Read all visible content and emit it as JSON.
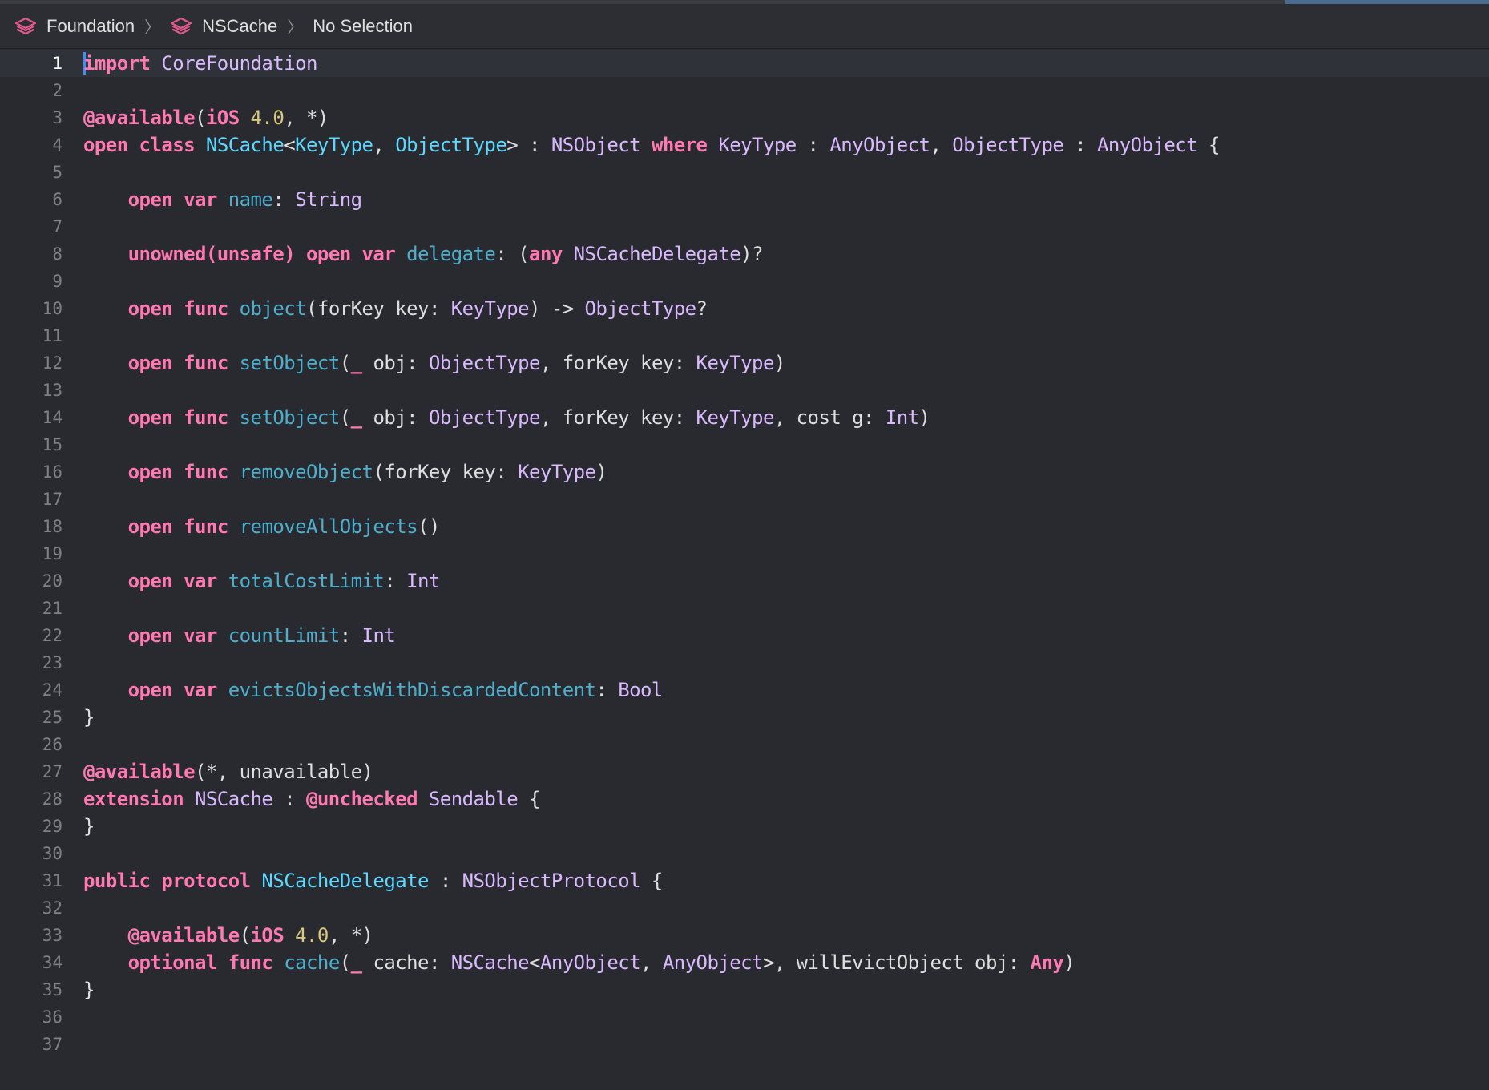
{
  "breadcrumb": {
    "items": [
      "Foundation",
      "NSCache",
      "No Selection"
    ]
  },
  "editor": {
    "current_line": 1,
    "lines": [
      {
        "n": "1",
        "tokens": [
          [
            "kw",
            "import"
          ],
          [
            "plain",
            " "
          ],
          [
            "ty",
            "CoreFoundation"
          ]
        ]
      },
      {
        "n": "2",
        "tokens": []
      },
      {
        "n": "3",
        "tokens": [
          [
            "attr",
            "@available"
          ],
          [
            "plain",
            "("
          ],
          [
            "kw",
            "iOS"
          ],
          [
            "plain",
            " "
          ],
          [
            "num",
            "4.0"
          ],
          [
            "plain",
            ", *)"
          ]
        ]
      },
      {
        "n": "4",
        "tokens": [
          [
            "kw",
            "open"
          ],
          [
            "plain",
            " "
          ],
          [
            "kw",
            "class"
          ],
          [
            "plain",
            " "
          ],
          [
            "decl",
            "NSCache"
          ],
          [
            "plain",
            "<"
          ],
          [
            "decl",
            "KeyType"
          ],
          [
            "plain",
            ", "
          ],
          [
            "decl",
            "ObjectType"
          ],
          [
            "plain",
            "> : "
          ],
          [
            "ty",
            "NSObject"
          ],
          [
            "plain",
            " "
          ],
          [
            "kw",
            "where"
          ],
          [
            "plain",
            " "
          ],
          [
            "ty",
            "KeyType"
          ],
          [
            "plain",
            " : "
          ],
          [
            "ty",
            "AnyObject"
          ],
          [
            "plain",
            ", "
          ],
          [
            "ty",
            "ObjectType"
          ],
          [
            "plain",
            " : "
          ],
          [
            "ty",
            "AnyObject"
          ],
          [
            "plain",
            " {"
          ]
        ]
      },
      {
        "n": "5",
        "tokens": []
      },
      {
        "n": "6",
        "tokens": [
          [
            "plain",
            "    "
          ],
          [
            "kw",
            "open"
          ],
          [
            "plain",
            " "
          ],
          [
            "kw",
            "var"
          ],
          [
            "plain",
            " "
          ],
          [
            "mem",
            "name"
          ],
          [
            "plain",
            ": "
          ],
          [
            "ty",
            "String"
          ]
        ]
      },
      {
        "n": "7",
        "tokens": []
      },
      {
        "n": "8",
        "tokens": [
          [
            "plain",
            "    "
          ],
          [
            "kw",
            "unowned(unsafe)"
          ],
          [
            "plain",
            " "
          ],
          [
            "kw",
            "open"
          ],
          [
            "plain",
            " "
          ],
          [
            "kw",
            "var"
          ],
          [
            "plain",
            " "
          ],
          [
            "mem",
            "delegate"
          ],
          [
            "plain",
            ": ("
          ],
          [
            "kw",
            "any"
          ],
          [
            "plain",
            " "
          ],
          [
            "ty",
            "NSCacheDelegate"
          ],
          [
            "plain",
            ")?"
          ]
        ]
      },
      {
        "n": "9",
        "tokens": []
      },
      {
        "n": "10",
        "tokens": [
          [
            "plain",
            "    "
          ],
          [
            "kw",
            "open"
          ],
          [
            "plain",
            " "
          ],
          [
            "kw",
            "func"
          ],
          [
            "plain",
            " "
          ],
          [
            "mem",
            "object"
          ],
          [
            "plain",
            "(forKey key: "
          ],
          [
            "ty",
            "KeyType"
          ],
          [
            "plain",
            ") -> "
          ],
          [
            "ty",
            "ObjectType"
          ],
          [
            "plain",
            "?"
          ]
        ]
      },
      {
        "n": "11",
        "tokens": []
      },
      {
        "n": "12",
        "tokens": [
          [
            "plain",
            "    "
          ],
          [
            "kw",
            "open"
          ],
          [
            "plain",
            " "
          ],
          [
            "kw",
            "func"
          ],
          [
            "plain",
            " "
          ],
          [
            "mem",
            "setObject"
          ],
          [
            "plain",
            "("
          ],
          [
            "kw",
            "_"
          ],
          [
            "plain",
            " obj: "
          ],
          [
            "ty",
            "ObjectType"
          ],
          [
            "plain",
            ", forKey key: "
          ],
          [
            "ty",
            "KeyType"
          ],
          [
            "plain",
            ")"
          ]
        ]
      },
      {
        "n": "13",
        "tokens": []
      },
      {
        "n": "14",
        "tokens": [
          [
            "plain",
            "    "
          ],
          [
            "kw",
            "open"
          ],
          [
            "plain",
            " "
          ],
          [
            "kw",
            "func"
          ],
          [
            "plain",
            " "
          ],
          [
            "mem",
            "setObject"
          ],
          [
            "plain",
            "("
          ],
          [
            "kw",
            "_"
          ],
          [
            "plain",
            " obj: "
          ],
          [
            "ty",
            "ObjectType"
          ],
          [
            "plain",
            ", forKey key: "
          ],
          [
            "ty",
            "KeyType"
          ],
          [
            "plain",
            ", cost g: "
          ],
          [
            "ty",
            "Int"
          ],
          [
            "plain",
            ")"
          ]
        ]
      },
      {
        "n": "15",
        "tokens": []
      },
      {
        "n": "16",
        "tokens": [
          [
            "plain",
            "    "
          ],
          [
            "kw",
            "open"
          ],
          [
            "plain",
            " "
          ],
          [
            "kw",
            "func"
          ],
          [
            "plain",
            " "
          ],
          [
            "mem",
            "removeObject"
          ],
          [
            "plain",
            "(forKey key: "
          ],
          [
            "ty",
            "KeyType"
          ],
          [
            "plain",
            ")"
          ]
        ]
      },
      {
        "n": "17",
        "tokens": []
      },
      {
        "n": "18",
        "tokens": [
          [
            "plain",
            "    "
          ],
          [
            "kw",
            "open"
          ],
          [
            "plain",
            " "
          ],
          [
            "kw",
            "func"
          ],
          [
            "plain",
            " "
          ],
          [
            "mem",
            "removeAllObjects"
          ],
          [
            "plain",
            "()"
          ]
        ]
      },
      {
        "n": "19",
        "tokens": []
      },
      {
        "n": "20",
        "tokens": [
          [
            "plain",
            "    "
          ],
          [
            "kw",
            "open"
          ],
          [
            "plain",
            " "
          ],
          [
            "kw",
            "var"
          ],
          [
            "plain",
            " "
          ],
          [
            "mem",
            "totalCostLimit"
          ],
          [
            "plain",
            ": "
          ],
          [
            "ty",
            "Int"
          ]
        ]
      },
      {
        "n": "21",
        "tokens": []
      },
      {
        "n": "22",
        "tokens": [
          [
            "plain",
            "    "
          ],
          [
            "kw",
            "open"
          ],
          [
            "plain",
            " "
          ],
          [
            "kw",
            "var"
          ],
          [
            "plain",
            " "
          ],
          [
            "mem",
            "countLimit"
          ],
          [
            "plain",
            ": "
          ],
          [
            "ty",
            "Int"
          ]
        ]
      },
      {
        "n": "23",
        "tokens": []
      },
      {
        "n": "24",
        "tokens": [
          [
            "plain",
            "    "
          ],
          [
            "kw",
            "open"
          ],
          [
            "plain",
            " "
          ],
          [
            "kw",
            "var"
          ],
          [
            "plain",
            " "
          ],
          [
            "mem",
            "evictsObjectsWithDiscardedContent"
          ],
          [
            "plain",
            ": "
          ],
          [
            "ty",
            "Bool"
          ]
        ]
      },
      {
        "n": "25",
        "tokens": [
          [
            "plain",
            "}"
          ]
        ]
      },
      {
        "n": "26",
        "tokens": []
      },
      {
        "n": "27",
        "tokens": [
          [
            "attr",
            "@available"
          ],
          [
            "plain",
            "(*, unavailable)"
          ]
        ]
      },
      {
        "n": "28",
        "tokens": [
          [
            "kw",
            "extension"
          ],
          [
            "plain",
            " "
          ],
          [
            "ty",
            "NSCache"
          ],
          [
            "plain",
            " : "
          ],
          [
            "attr",
            "@unchecked"
          ],
          [
            "plain",
            " "
          ],
          [
            "ty",
            "Sendable"
          ],
          [
            "plain",
            " {"
          ]
        ]
      },
      {
        "n": "29",
        "tokens": [
          [
            "plain",
            "}"
          ]
        ]
      },
      {
        "n": "30",
        "tokens": []
      },
      {
        "n": "31",
        "tokens": [
          [
            "kw",
            "public"
          ],
          [
            "plain",
            " "
          ],
          [
            "kw",
            "protocol"
          ],
          [
            "plain",
            " "
          ],
          [
            "decl",
            "NSCacheDelegate"
          ],
          [
            "plain",
            " : "
          ],
          [
            "ty",
            "NSObjectProtocol"
          ],
          [
            "plain",
            " {"
          ]
        ]
      },
      {
        "n": "32",
        "tokens": []
      },
      {
        "n": "33",
        "tokens": [
          [
            "plain",
            "    "
          ],
          [
            "attr",
            "@available"
          ],
          [
            "plain",
            "("
          ],
          [
            "kw",
            "iOS"
          ],
          [
            "plain",
            " "
          ],
          [
            "num",
            "4.0"
          ],
          [
            "plain",
            ", *)"
          ]
        ]
      },
      {
        "n": "34",
        "tokens": [
          [
            "plain",
            "    "
          ],
          [
            "kw",
            "optional"
          ],
          [
            "plain",
            " "
          ],
          [
            "kw",
            "func"
          ],
          [
            "plain",
            " "
          ],
          [
            "mem",
            "cache"
          ],
          [
            "plain",
            "("
          ],
          [
            "kw",
            "_"
          ],
          [
            "plain",
            " cache: "
          ],
          [
            "ty",
            "NSCache"
          ],
          [
            "plain",
            "<"
          ],
          [
            "ty",
            "AnyObject"
          ],
          [
            "plain",
            ", "
          ],
          [
            "ty",
            "AnyObject"
          ],
          [
            "plain",
            ">, willEvictObject obj: "
          ],
          [
            "kw",
            "Any"
          ],
          [
            "plain",
            ")"
          ]
        ]
      },
      {
        "n": "35",
        "tokens": [
          [
            "plain",
            "}"
          ]
        ]
      },
      {
        "n": "36",
        "tokens": []
      },
      {
        "n": "37",
        "tokens": []
      }
    ]
  }
}
